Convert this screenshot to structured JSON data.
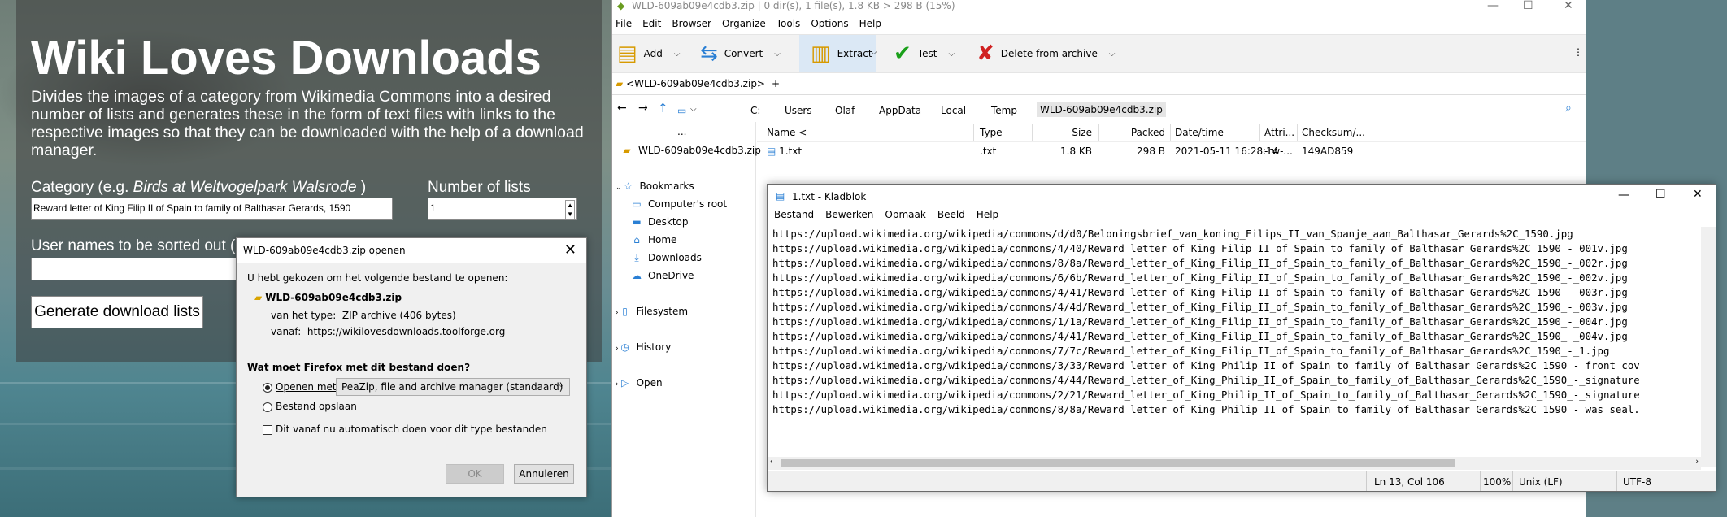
{
  "wiki": {
    "title": "Wiki Loves Downloads",
    "description": "Divides the images of a category from Wikimedia Commons into a desired number of lists and generates these in the form of text files with links to the respective images so that they can be downloaded with the help of a download manager.",
    "category_label_prefix": "Category (e.g. ",
    "category_label_example": "Birds at Weltvogelpark Walsrode",
    "category_label_suffix": " )",
    "category_value": "Reward letter of King Filip II of Spain to family of Balthasar Gerards, 1590",
    "num_lists_label": "Number of lists",
    "num_lists_value": "1",
    "usernames_label": "User names to be sorted out ( e",
    "generate_button": "Generate download lists"
  },
  "firefox_dialog": {
    "title": "WLD-609ab09e4cdb3.zip openen",
    "intro": "U hebt gekozen om het volgende bestand te openen:",
    "filename": "WLD-609ab09e4cdb3.zip",
    "type_label": "van het type:",
    "type_value": "ZIP archive (406 bytes)",
    "from_label": "vanaf:",
    "from_value": "https://wikilovesdownloads.toolforge.org",
    "question": "Wat moet Firefox met dit bestand doen?",
    "open_with_label": "Openen met",
    "open_with_value": "PeaZip, file and archive manager (standaard)",
    "save_label": "Bestand opslaan",
    "auto_label": "Dit vanaf nu automatisch doen voor dit type bestanden",
    "ok": "OK",
    "cancel": "Annuleren"
  },
  "peazip": {
    "title": "WLD-609ab09e4cdb3.zip | 0 dir(s), 1 file(s), 1.8 KB > 298 B (15%)",
    "menu": [
      "File",
      "Edit",
      "Browser",
      "Organize",
      "Tools",
      "Options",
      "Help"
    ],
    "toolbar": [
      "Add",
      "Convert",
      "Extract",
      "Test",
      "Delete from archive"
    ],
    "tab": "<WLD-609ab09e4cdb3.zip>",
    "tab_plus": "+",
    "path": [
      "C:",
      "Users",
      "Olaf",
      "AppData",
      "Local",
      "Temp",
      "WLD-609ab09e4cdb3.zip"
    ],
    "nav": {
      "dots": "...",
      "archive": "WLD-609ab09e4cdb3.zip",
      "bookmarks": "Bookmarks",
      "computer": "Computer's root",
      "desktop": "Desktop",
      "home": "Home",
      "downloads": "Downloads",
      "onedrive": "OneDrive",
      "filesystem": "Filesystem",
      "history": "History",
      "open": "Open"
    },
    "columns": [
      "Name <",
      "Type",
      "Size",
      "Packed",
      "Date/time",
      "Attri...",
      "Checksum/..."
    ],
    "row": [
      "1.txt",
      ".txt",
      "1.8 KB",
      "298 B",
      "2021-05-11 16:28:14",
      "-rw-...",
      "149AD859"
    ]
  },
  "notepad": {
    "title": "1.txt - Kladblok",
    "menu": [
      "Bestand",
      "Bewerken",
      "Opmaak",
      "Beeld",
      "Help"
    ],
    "lines": [
      "https://upload.wikimedia.org/wikipedia/commons/d/d0/Beloningsbrief_van_koning_Filips_II_van_Spanje_aan_Balthasar_Gerards%2C_1590.jpg",
      "https://upload.wikimedia.org/wikipedia/commons/4/40/Reward_letter_of_King_Filip_II_of_Spain_to_family_of_Balthasar_Gerards%2C_1590_-_001v.jpg",
      "https://upload.wikimedia.org/wikipedia/commons/8/8a/Reward_letter_of_King_Filip_II_of_Spain_to_family_of_Balthasar_Gerards%2C_1590_-_002r.jpg",
      "https://upload.wikimedia.org/wikipedia/commons/6/6b/Reward_letter_of_King_Filip_II_of_Spain_to_family_of_Balthasar_Gerards%2C_1590_-_002v.jpg",
      "https://upload.wikimedia.org/wikipedia/commons/4/41/Reward_letter_of_King_Filip_II_of_Spain_to_family_of_Balthasar_Gerards%2C_1590_-_003r.jpg",
      "https://upload.wikimedia.org/wikipedia/commons/4/4d/Reward_letter_of_King_Filip_II_of_Spain_to_family_of_Balthasar_Gerards%2C_1590_-_003v.jpg",
      "https://upload.wikimedia.org/wikipedia/commons/1/1a/Reward_letter_of_King_Filip_II_of_Spain_to_family_of_Balthasar_Gerards%2C_1590_-_004r.jpg",
      "https://upload.wikimedia.org/wikipedia/commons/4/41/Reward_letter_of_King_Filip_II_of_Spain_to_family_of_Balthasar_Gerards%2C_1590_-_004v.jpg",
      "https://upload.wikimedia.org/wikipedia/commons/7/7c/Reward_letter_of_King_Filip_II_of_Spain_to_family_of_Balthasar_Gerards%2C_1590_-_1.jpg",
      "https://upload.wikimedia.org/wikipedia/commons/3/33/Reward_letter_of_King_Philip_II_of_Spain_to_family_of_Balthasar_Gerards%2C_1590_-_front_cov",
      "https://upload.wikimedia.org/wikipedia/commons/4/44/Reward_letter_of_King_Philip_II_of_Spain_to_family_of_Balthasar_Gerards%2C_1590_-_signature",
      "https://upload.wikimedia.org/wikipedia/commons/2/21/Reward_letter_of_King_Philip_II_of_Spain_to_family_of_Balthasar_Gerards%2C_1590_-_signature",
      "https://upload.wikimedia.org/wikipedia/commons/8/8a/Reward_letter_of_King_Philip_II_of_Spain_to_family_of_Balthasar_Gerards%2C_1590_-_was_seal."
    ],
    "status": {
      "position": "Ln 13, Col 106",
      "zoom": "100%",
      "eol": "Unix (LF)",
      "encoding": "UTF-8"
    }
  }
}
